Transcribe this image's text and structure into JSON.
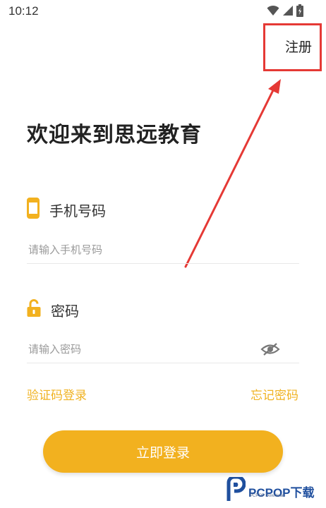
{
  "status_bar": {
    "time": "10:12"
  },
  "header": {
    "register_label": "注册"
  },
  "main": {
    "title": "欢迎来到思远教育",
    "phone": {
      "label": "手机号码",
      "placeholder": "请输入手机号码",
      "value": ""
    },
    "password": {
      "label": "密码",
      "placeholder": "请输入密码",
      "value": ""
    },
    "sms_login_label": "验证码登录",
    "forgot_password_label": "忘记密码",
    "login_button_label": "立即登录"
  },
  "watermark": {
    "brand": "PCPOP下载",
    "sub": "PCPOP Download"
  },
  "colors": {
    "accent": "#f2b11f",
    "link": "#f0b323",
    "annotation_red": "#e53935",
    "watermark_blue": "#1f4f9e"
  },
  "icons": {
    "phone": "phone-icon",
    "unlock": "unlock-icon",
    "visibility_off": "eye-off-icon",
    "wifi": "wifi-icon",
    "signal": "signal-icon",
    "battery": "battery-icon"
  }
}
